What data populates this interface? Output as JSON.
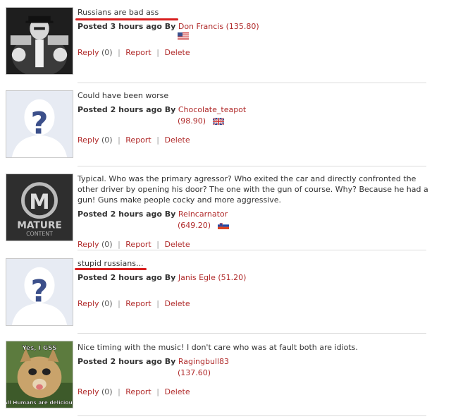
{
  "comments": [
    {
      "text": "Russians are bad ass",
      "posted": "Posted 3 hours ago By",
      "user": "Don Francis",
      "score": "(135.80)",
      "flag": "us",
      "avatar": "gunman",
      "reply": "Reply",
      "count": "(0)",
      "report": "Report",
      "delete": "Delete"
    },
    {
      "text": "Could have been worse",
      "posted": "Posted 2 hours ago By",
      "user": "Chocolate_teapot",
      "score": "(98.90)",
      "flag": "uk",
      "avatar": "placeholder",
      "reply": "Reply",
      "count": "(0)",
      "report": "Report",
      "delete": "Delete"
    },
    {
      "text": "Typical. Who was the primary agressor? Who exited the car and directly confronted the other driver by opening his door? The one with the gun of course. Why? Because he had a gun! Guns make people cocky and more aggressive.",
      "posted": "Posted 2 hours ago By",
      "user": "Reincarnator",
      "score": "(649.20)",
      "flag": "si",
      "avatar": "mature",
      "avatar_text": {
        "letter": "M",
        "line1": "MATURE",
        "line2": "CONTENT"
      },
      "reply": "Reply",
      "count": "(0)",
      "report": "Report",
      "delete": "Delete"
    },
    {
      "text": "stupid russians...",
      "posted": "Posted 2 hours ago By",
      "user": "Janis Egle",
      "score": "(51.20)",
      "flag": "",
      "avatar": "placeholder",
      "reply": "Reply",
      "count": "(0)",
      "report": "Report",
      "delete": "Delete"
    },
    {
      "text": "Nice timing with the music! I don't care who was at fault both are idiots.",
      "posted": "Posted 2 hours ago By",
      "user": "Ragingbull83",
      "score": "(137.60)",
      "flag": "",
      "avatar": "cat",
      "avatar_text": {
        "top": "Yes, I GSS",
        "bottom": "All Humans are delicious"
      },
      "reply": "Reply",
      "count": "(0)",
      "report": "Report",
      "delete": "Delete"
    }
  ],
  "colors": {
    "link": "#b02a2a",
    "highlight": "#d81e1e"
  }
}
